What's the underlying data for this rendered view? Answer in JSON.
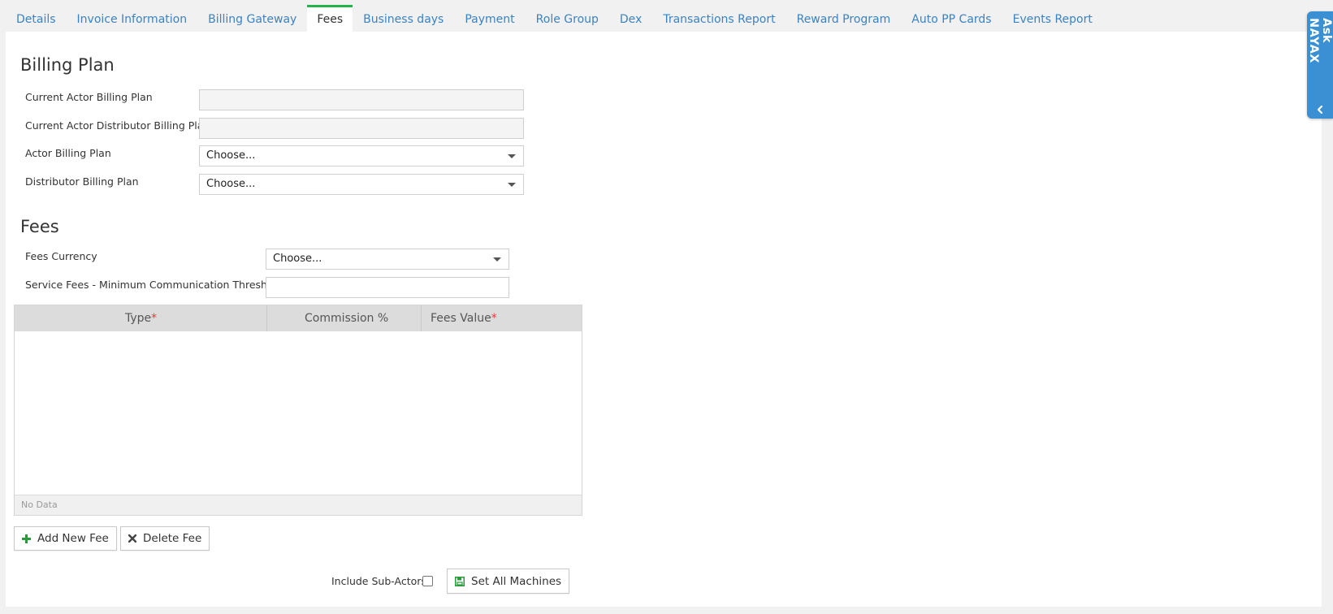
{
  "tabs": [
    {
      "label": "Details"
    },
    {
      "label": "Invoice Information"
    },
    {
      "label": "Billing Gateway"
    },
    {
      "label": "Fees",
      "active": true
    },
    {
      "label": "Business days"
    },
    {
      "label": "Payment"
    },
    {
      "label": "Role Group"
    },
    {
      "label": "Dex"
    },
    {
      "label": "Transactions Report"
    },
    {
      "label": "Reward Program"
    },
    {
      "label": "Auto PP Cards"
    },
    {
      "label": "Events Report"
    }
  ],
  "billing_plan": {
    "title": "Billing Plan",
    "current_actor_label": "Current Actor Billing Plan",
    "current_actor_value": "",
    "current_distributor_label": "Current Actor Distributor Billing Plan",
    "current_distributor_value": "",
    "actor_plan_label": "Actor Billing Plan",
    "actor_plan_value": "Choose...",
    "distributor_plan_label": "Distributor Billing Plan",
    "distributor_plan_value": "Choose..."
  },
  "fees": {
    "title": "Fees",
    "currency_label": "Fees Currency",
    "currency_value": "Choose...",
    "threshold_label": "Service Fees - Minimum Communication Threshold",
    "threshold_value": ""
  },
  "grid": {
    "columns": [
      {
        "label": "Type",
        "required": "*"
      },
      {
        "label": "Commission %",
        "required": ""
      },
      {
        "label": "Fees Value",
        "required": "*"
      }
    ],
    "rows": [],
    "footer": "No Data"
  },
  "buttons": {
    "add_fee": "Add New Fee",
    "delete_fee": "Delete Fee",
    "include_sub_actors": "Include Sub-Actors",
    "include_sub_actors_checked": false,
    "set_all_machines": "Set All Machines"
  },
  "ask_widget": {
    "label": "Ask NAYAX"
  },
  "colors": {
    "link": "#3b83c0",
    "active_tab_accent": "#24b24b",
    "ask_widget": "#3b8fd3",
    "required": "#e23b3b",
    "add_icon": "#2a9a3a",
    "save_icon": "#2a9a3a"
  },
  "icons": {
    "add_fee": "plus-icon",
    "delete_fee": "times-icon",
    "set_all_machines": "save-icon",
    "ask_toggle": "chevron-left-icon",
    "dropdown": "caret-down-icon"
  }
}
